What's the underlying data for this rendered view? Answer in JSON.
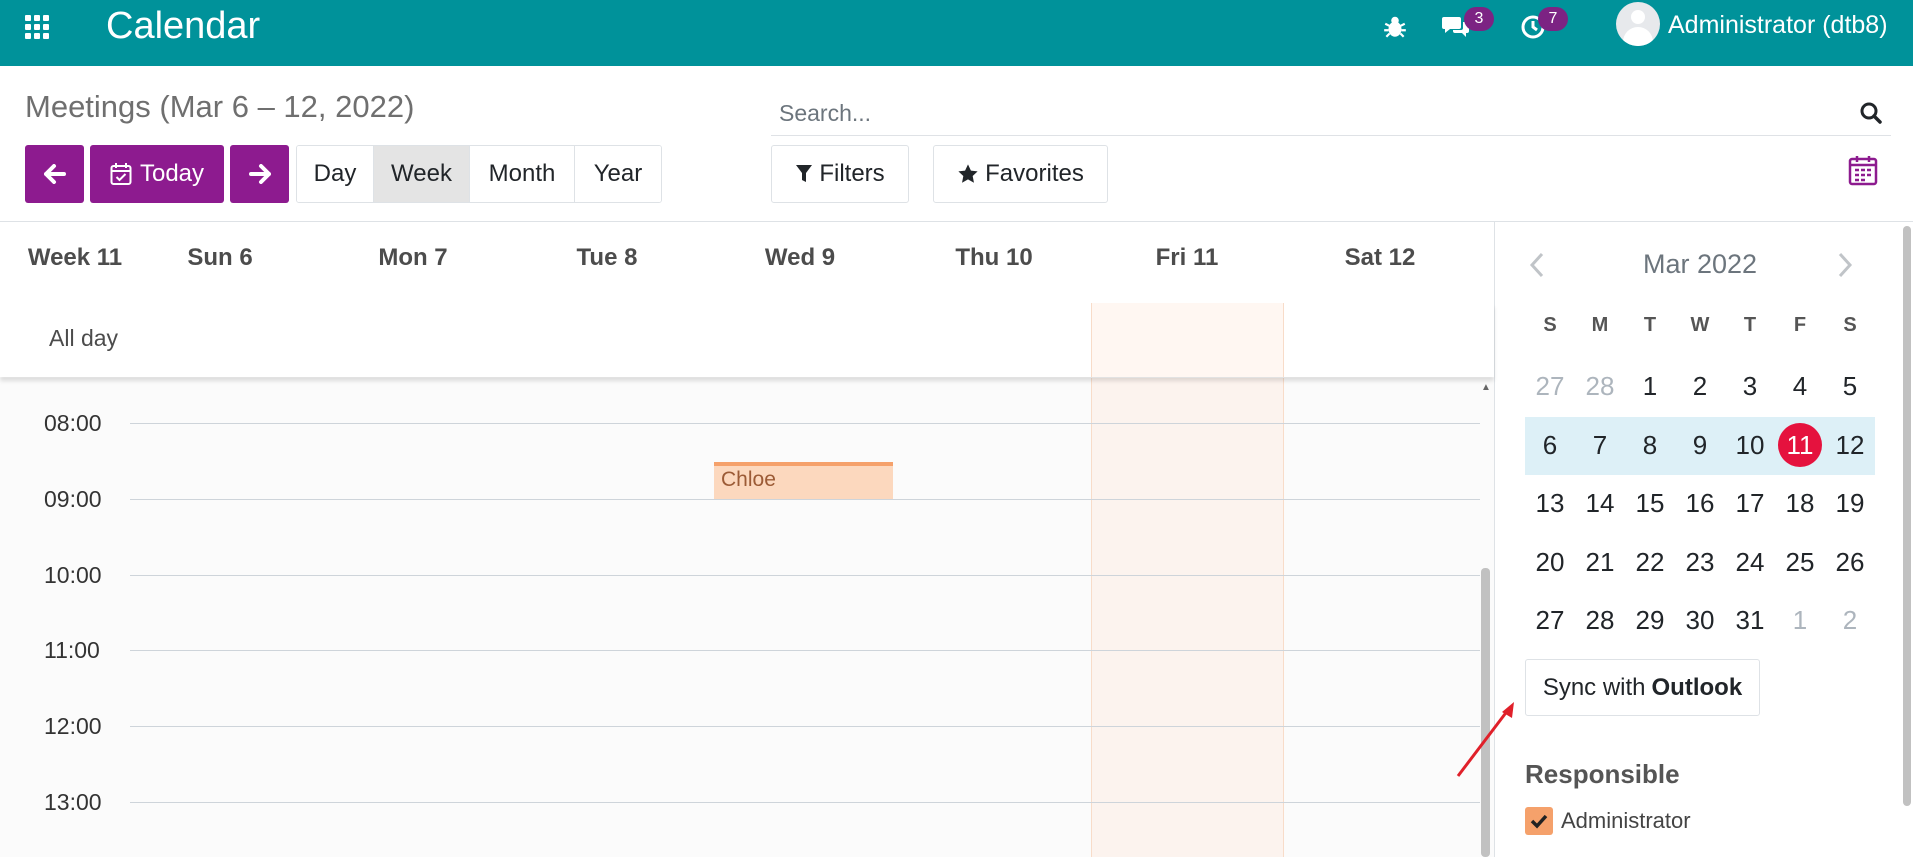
{
  "navbar": {
    "app_title": "Calendar",
    "messages_count": "3",
    "activities_count": "7",
    "user_name": "Administrator (dtb8)",
    "icons": [
      "apps-icon",
      "bug-icon",
      "chat-icon",
      "clock-icon",
      "avatar"
    ]
  },
  "control": {
    "title": "Meetings (Mar 6 – 12, 2022)",
    "today_label": "Today",
    "scales": [
      "Day",
      "Week",
      "Month",
      "Year"
    ],
    "active_scale": "Week",
    "search_placeholder": "Search...",
    "filters_label": "Filters",
    "favorites_label": "Favorites"
  },
  "calendar": {
    "week_label": "Week 11",
    "days": [
      "Sun 6",
      "Mon 7",
      "Tue 8",
      "Wed 9",
      "Thu 10",
      "Fri 11",
      "Sat 12"
    ],
    "today": "Fri 11",
    "allday_label": "All day",
    "hours": [
      "08:00",
      "09:00",
      "10:00",
      "11:00",
      "12:00",
      "13:00"
    ],
    "events": [
      {
        "title": "Chloe",
        "day": "Wed 9",
        "start": "08:30",
        "end": "09:00",
        "color": "#fcd8be"
      }
    ]
  },
  "sidebar": {
    "mini_title": "Mar 2022",
    "dow": [
      "S",
      "M",
      "T",
      "W",
      "T",
      "F",
      "S"
    ],
    "weeks": [
      [
        "27",
        "28",
        "1",
        "2",
        "3",
        "4",
        "5"
      ],
      [
        "6",
        "7",
        "8",
        "9",
        "10",
        "11",
        "12"
      ],
      [
        "13",
        "14",
        "15",
        "16",
        "17",
        "18",
        "19"
      ],
      [
        "20",
        "21",
        "22",
        "23",
        "24",
        "25",
        "26"
      ],
      [
        "27",
        "28",
        "29",
        "30",
        "31",
        "1",
        "2"
      ]
    ],
    "selected_week_index": 1,
    "today_date": "11",
    "sync_prefix": "Sync with",
    "sync_brand": "Outlook",
    "responsible_title": "Responsible",
    "responsible": [
      {
        "name": "Administrator",
        "checked": true
      }
    ]
  },
  "colors": {
    "navbar": "#00929a",
    "primary": "#8d1b8f",
    "badge": "#7c2383",
    "today_dot": "#e5123e",
    "event": "#fcd8be",
    "arrow": "#e0202a"
  }
}
